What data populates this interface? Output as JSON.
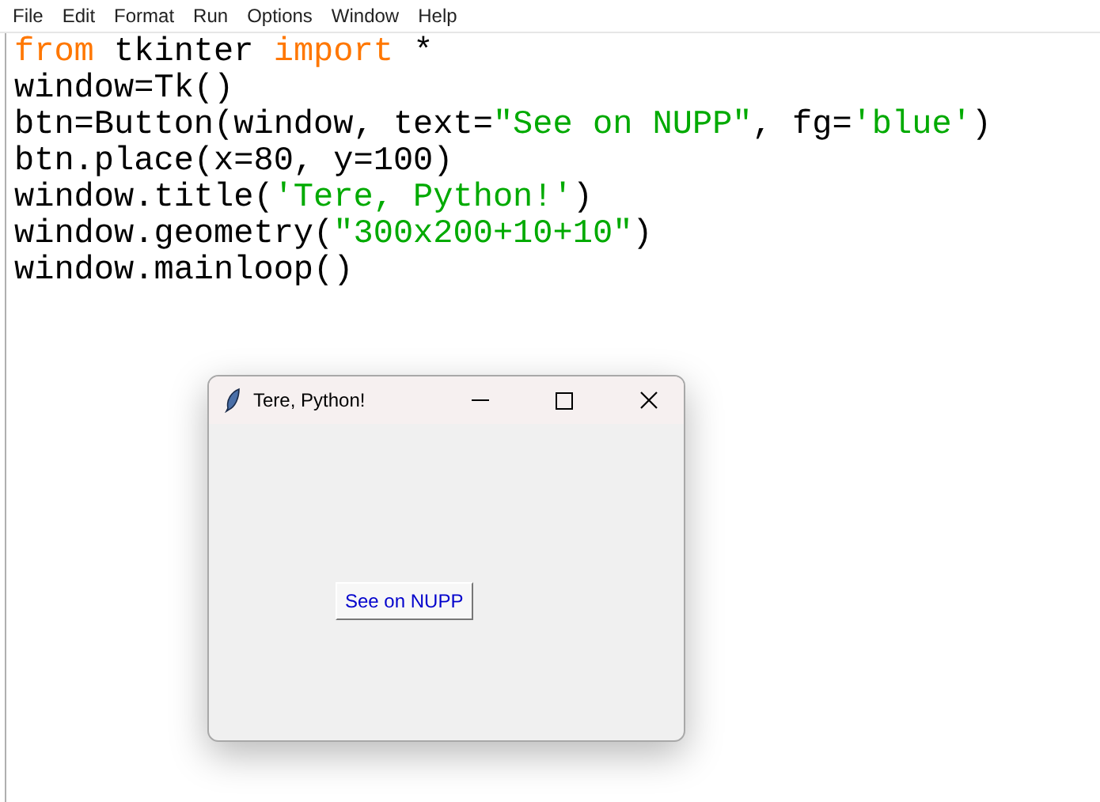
{
  "menu": [
    "File",
    "Edit",
    "Format",
    "Run",
    "Options",
    "Window",
    "Help"
  ],
  "code_lines": [
    [
      {
        "kind": "keyword",
        "text": "from"
      },
      {
        "kind": "plain",
        "text": " tkinter "
      },
      {
        "kind": "keyword",
        "text": "import"
      },
      {
        "kind": "plain",
        "text": " *"
      }
    ],
    [
      {
        "kind": "plain",
        "text": "window=Tk()"
      }
    ],
    [
      {
        "kind": "plain",
        "text": "btn=Button(window, text="
      },
      {
        "kind": "string",
        "text": "\"See on NUPP\""
      },
      {
        "kind": "plain",
        "text": ", fg="
      },
      {
        "kind": "string",
        "text": "'blue'"
      },
      {
        "kind": "plain",
        "text": ")"
      }
    ],
    [
      {
        "kind": "plain",
        "text": "btn.place(x=80, y=100)"
      }
    ],
    [
      {
        "kind": "plain",
        "text": "window.title("
      },
      {
        "kind": "string",
        "text": "'Tere, Python!'"
      },
      {
        "kind": "plain",
        "text": ")"
      }
    ],
    [
      {
        "kind": "plain",
        "text": "window.geometry("
      },
      {
        "kind": "string",
        "text": "\"300x200+10+10\""
      },
      {
        "kind": "plain",
        "text": ")"
      }
    ],
    [
      {
        "kind": "plain",
        "text": "window.mainloop()"
      }
    ]
  ],
  "tk_window": {
    "title": "Tere, Python!",
    "button": "See on NUPP"
  }
}
